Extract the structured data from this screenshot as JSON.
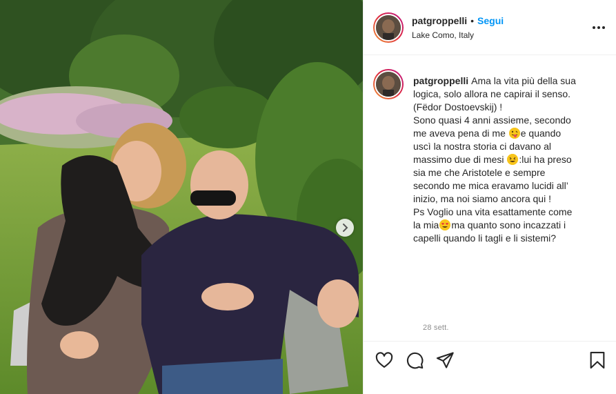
{
  "post": {
    "username": "patgroppelli",
    "dot": "•",
    "follow_label": "Segui",
    "location": "Lake Como, Italy",
    "caption_lines": [
      "Ama la vita più della sua",
      "logica, solo allora ne capirai il senso.",
      "(Fëdor Dostoevskij) !",
      "Sono quasi 4 anni assieme, secondo",
      "me aveva pena di me",
      "e quando",
      "uscì la nostra storia ci davano al",
      "massimo due di mesi",
      ":lui ha preso",
      "sia me che Aristotele e sempre",
      "secondo me mica eravamo lucidi all’",
      "inizio, ma noi siamo ancora qui !",
      "Ps Voglio una vita esattamente come",
      "la mia",
      "ma quanto sono incazzati i",
      "capelli quando li tagli e li sistemi?"
    ],
    "timestamp": "28 sett."
  },
  "icons": {
    "more": "more-options-icon",
    "next": "chevron-right-icon",
    "like": "heart-icon",
    "comment": "comment-icon",
    "share": "send-icon",
    "save": "bookmark-icon",
    "emoji_1": "face-with-tongue-emoji",
    "emoji_2": "rolling-laughing-emoji",
    "emoji_3": "heart-eyes-emoji"
  },
  "colors": {
    "accent": "#0095f6",
    "text": "#262626",
    "muted": "#8e8e8e",
    "border": "#efefef"
  }
}
